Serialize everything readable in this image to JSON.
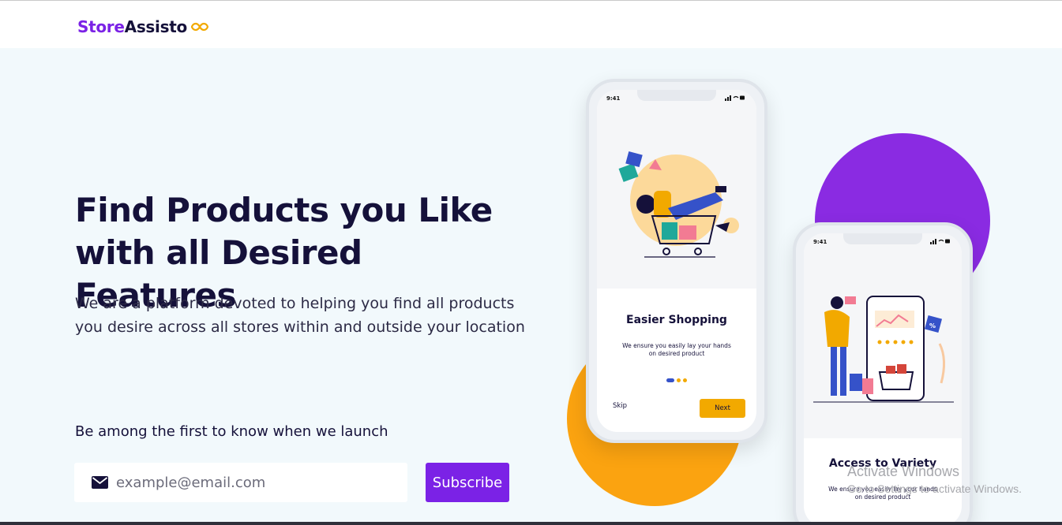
{
  "brand": {
    "part1": "Store",
    "part2": "Assisto",
    "icon": "infinity-icon",
    "primary_color": "#7b22e6",
    "accent_color": "#f2a900"
  },
  "hero": {
    "title": "Find Products you Like with all Desired Features",
    "subtitle": "We are a platform devoted to helping you find all products you desire across all stores within and outside your location"
  },
  "newsletter": {
    "label": "Be among the first to know when we launch",
    "email_placeholder": "example@email.com",
    "email_value": "",
    "button_label": "Subscribe",
    "icon": "mail-icon"
  },
  "phone1": {
    "time": "9:41",
    "title": "Easier Shopping",
    "description": "We ensure you easily lay your hands on desired product",
    "skip_label": "Skip",
    "next_label": "Next"
  },
  "phone2": {
    "time": "9:41",
    "title": "Access to Variety",
    "description": "We ensure you easily lay your hands on desired product"
  },
  "system_overlay": {
    "line1": "Activate Windows",
    "line2": "Go to Settings to activate Windows."
  }
}
